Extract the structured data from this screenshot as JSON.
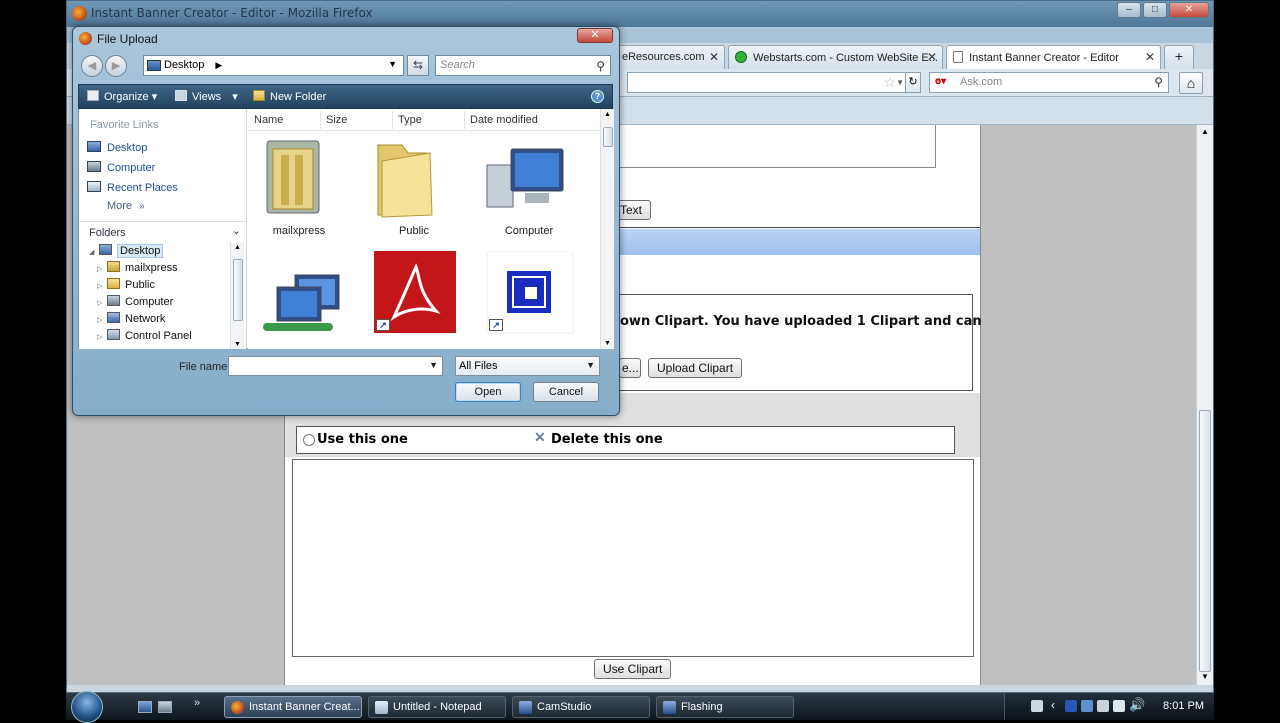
{
  "firefox": {
    "title": "Instant Banner Creator - Editor - Mozilla Firefox",
    "tabs": [
      {
        "label": "eResources.com"
      },
      {
        "label": "Webstarts.com - Custom WebSite E..."
      },
      {
        "label": "Instant Banner Creator - Editor"
      }
    ],
    "new_tab": "+",
    "search_placeholder": "Ask.com",
    "home_glyph": "⌂"
  },
  "page": {
    "text_button": "Text",
    "upload_message": "own Clipart. You have uploaded 1 Clipart and can",
    "browse_button_fragment": "e...",
    "upload_clipart_button": "Upload Clipart",
    "use_this_one": "Use this one",
    "delete_this_one": "Delete this one",
    "use_clipart_button": "Use Clipart"
  },
  "dialog": {
    "title": "File Upload",
    "address": "Desktop",
    "search_placeholder": "Search",
    "toolbar": {
      "organize": "Organize",
      "views": "Views",
      "new_folder": "New Folder"
    },
    "favorite_links_title": "Favorite Links",
    "favorite_links": [
      {
        "label": "Desktop",
        "icon": "desktop-icon"
      },
      {
        "label": "Computer",
        "icon": "computer-icon"
      },
      {
        "label": "Recent Places",
        "icon": "recent-places-icon"
      }
    ],
    "more_label": "More",
    "folders_label": "Folders",
    "tree": [
      {
        "label": "Desktop",
        "icon": "desktop-icon",
        "selected": true
      },
      {
        "label": "mailxpress",
        "icon": "folder-icon"
      },
      {
        "label": "Public",
        "icon": "folder-icon"
      },
      {
        "label": "Computer",
        "icon": "computer-icon"
      },
      {
        "label": "Network",
        "icon": "network-icon"
      },
      {
        "label": "Control Panel",
        "icon": "control-panel-icon"
      }
    ],
    "columns": [
      "Name",
      "Size",
      "Type",
      "Date modified"
    ],
    "files": [
      {
        "label": "mailxpress",
        "icon": "folder-icon"
      },
      {
        "label": "Public",
        "icon": "folder-icon"
      },
      {
        "label": "Computer",
        "icon": "computer-icon"
      },
      {
        "label": "",
        "icon": "network-icon"
      },
      {
        "label": "",
        "icon": "adobe-reader-shortcut-icon"
      },
      {
        "label": "",
        "icon": "app-shortcut-icon"
      }
    ],
    "file_name_label": "File name:",
    "file_name_value": "",
    "file_type": "All Files",
    "open_button": "Open",
    "cancel_button": "Cancel"
  },
  "taskbar": {
    "buttons": [
      {
        "label": "Instant Banner Creat...",
        "active": true
      },
      {
        "label": "Untitled - Notepad",
        "active": false
      },
      {
        "label": "CamStudio",
        "active": false
      },
      {
        "label": "Flashing",
        "active": false
      }
    ],
    "clock": "8:01 PM"
  }
}
